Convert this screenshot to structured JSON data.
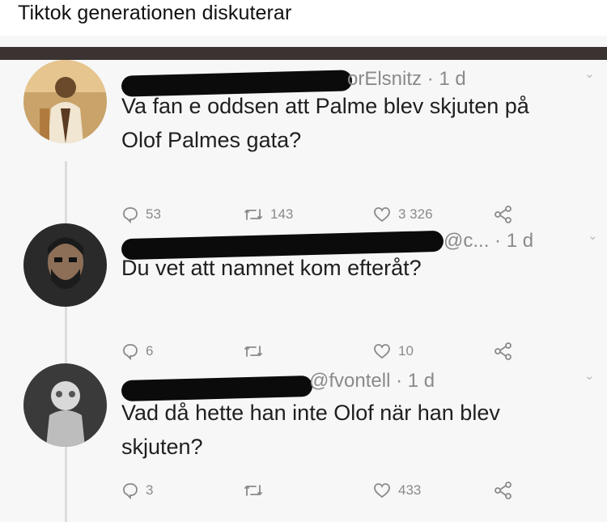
{
  "caption": "Tiktok generationen diskuterar",
  "tweets": [
    {
      "handle_visible": "orElsnitz · 1 d",
      "text": "Va fan e oddsen att Palme blev skjuten på\nOlof Palmes gata?",
      "replies": "53",
      "retweets": "143",
      "likes": "3 326"
    },
    {
      "handle_visible": "@c...  · 1 d",
      "text": "Du vet att namnet kom efteråt?",
      "replies": "6",
      "retweets": "",
      "likes": "10"
    },
    {
      "handle_visible": "@fvontell · 1 d",
      "text": "Vad då hette han inte Olof när han blev\nskjuten?",
      "replies": "3",
      "retweets": "",
      "likes": "433"
    }
  ],
  "icons": {
    "reply": "reply-icon",
    "retweet": "retweet-icon",
    "like": "heart-icon",
    "share": "share-icon",
    "menu": "chevron-down-icon"
  },
  "colors": {
    "text": "#1f1f1f",
    "muted": "#8a8a8a",
    "redaction": "#0b0b0b",
    "bar": "#3a3331"
  }
}
